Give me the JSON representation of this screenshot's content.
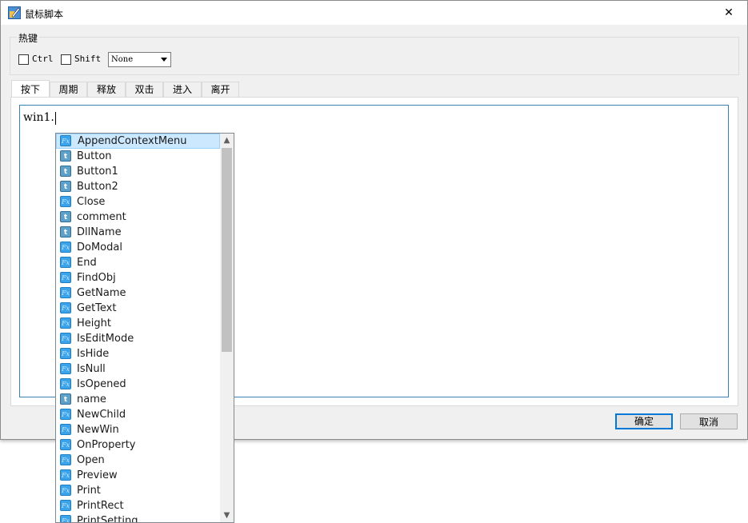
{
  "window": {
    "title": "鼠标脚本",
    "close_symbol": "✕"
  },
  "hotkey": {
    "group_label": "热键",
    "ctrl_label": "Ctrl",
    "shift_label": "Shift",
    "key_value": "None"
  },
  "tabs": [
    "按下",
    "周期",
    "释放",
    "双击",
    "进入",
    "离开"
  ],
  "editor": {
    "text": "win1."
  },
  "buttons": {
    "ok": "确定",
    "cancel": "取消"
  },
  "autocomplete": {
    "items": [
      {
        "label": "AppendContextMenu",
        "icon": "fx"
      },
      {
        "label": "Button",
        "icon": "t"
      },
      {
        "label": "Button1",
        "icon": "t"
      },
      {
        "label": "Button2",
        "icon": "t"
      },
      {
        "label": "Close",
        "icon": "fx"
      },
      {
        "label": "comment",
        "icon": "t"
      },
      {
        "label": "DllName",
        "icon": "t"
      },
      {
        "label": "DoModal",
        "icon": "fx"
      },
      {
        "label": "End",
        "icon": "fx"
      },
      {
        "label": "FindObj",
        "icon": "fx"
      },
      {
        "label": "GetName",
        "icon": "fx"
      },
      {
        "label": "GetText",
        "icon": "fx"
      },
      {
        "label": "Height",
        "icon": "fx"
      },
      {
        "label": "IsEditMode",
        "icon": "fx"
      },
      {
        "label": "IsHide",
        "icon": "fx"
      },
      {
        "label": "IsNull",
        "icon": "fx"
      },
      {
        "label": "IsOpened",
        "icon": "fx"
      },
      {
        "label": "name",
        "icon": "t"
      },
      {
        "label": "NewChild",
        "icon": "fx"
      },
      {
        "label": "NewWin",
        "icon": "fx"
      },
      {
        "label": "OnProperty",
        "icon": "fx"
      },
      {
        "label": "Open",
        "icon": "fx"
      },
      {
        "label": "Preview",
        "icon": "fx"
      },
      {
        "label": "Print",
        "icon": "fx"
      },
      {
        "label": "PrintRect",
        "icon": "fx"
      },
      {
        "label": "PrintSetting",
        "icon": "fx"
      }
    ],
    "selected_index": 0,
    "icon_text": {
      "fx": "Fx",
      "t": "t"
    }
  },
  "colors": {
    "accent": "#0078d7",
    "selection": "#cce8ff",
    "editor_border": "#3c7fb1"
  }
}
